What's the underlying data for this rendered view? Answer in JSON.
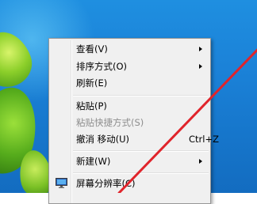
{
  "context_menu": {
    "items": [
      {
        "label": "查看(V)",
        "submenu": true
      },
      {
        "label": "排序方式(O)",
        "submenu": true
      },
      {
        "label": "刷新(E)",
        "submenu": false
      },
      {
        "label": "粘贴(P)",
        "submenu": false
      },
      {
        "label": "粘贴快捷方式(S)",
        "submenu": false,
        "disabled": true
      },
      {
        "label": "撤消 移动(U)",
        "shortcut": "Ctrl+Z",
        "submenu": false
      },
      {
        "label": "新建(W)",
        "submenu": true
      },
      {
        "label": "屏幕分辨率(C)",
        "icon": "monitor-icon",
        "submenu": false
      }
    ]
  },
  "colors": {
    "desktop_blue": "#1b82d8",
    "menu_background": "#f0f0f0",
    "arrow_red": "#e0242b",
    "disabled_text": "#8d8d8d"
  }
}
